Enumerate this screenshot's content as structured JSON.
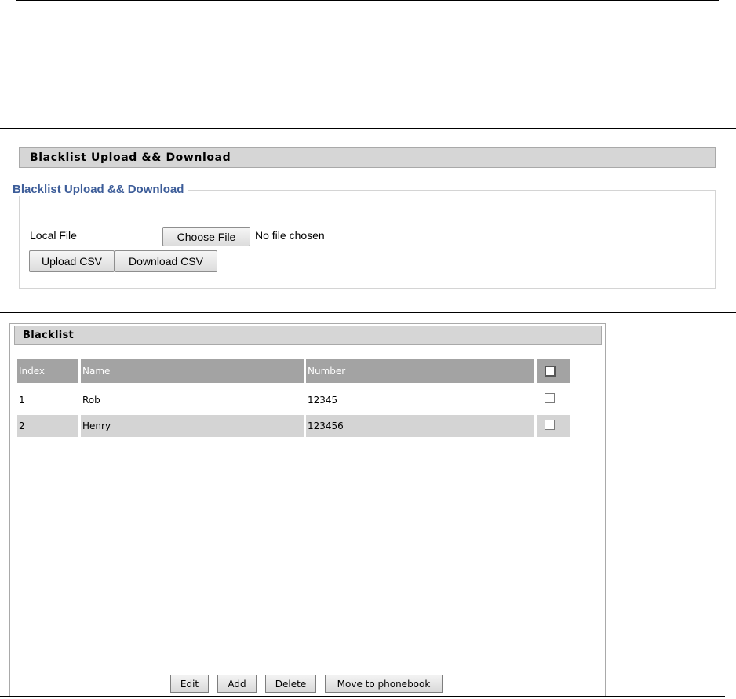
{
  "upload_section": {
    "header_title": "Blacklist Upload && Download",
    "legend": "Blacklist Upload && Download",
    "local_file_label": "Local File",
    "choose_file_label": "Choose File",
    "file_status": "No file chosen",
    "upload_csv_label": "Upload CSV",
    "download_csv_label": "Download CSV"
  },
  "blacklist": {
    "title": "Blacklist",
    "columns": [
      "Index",
      "Name",
      "Number"
    ],
    "rows": [
      {
        "index": "1",
        "name": "Rob",
        "number": "12345",
        "checked": false
      },
      {
        "index": "2",
        "name": "Henry",
        "number": "123456",
        "checked": false
      }
    ],
    "buttons": {
      "edit": "Edit",
      "add": "Add",
      "delete": "Delete",
      "move": "Move to phonebook"
    }
  }
}
